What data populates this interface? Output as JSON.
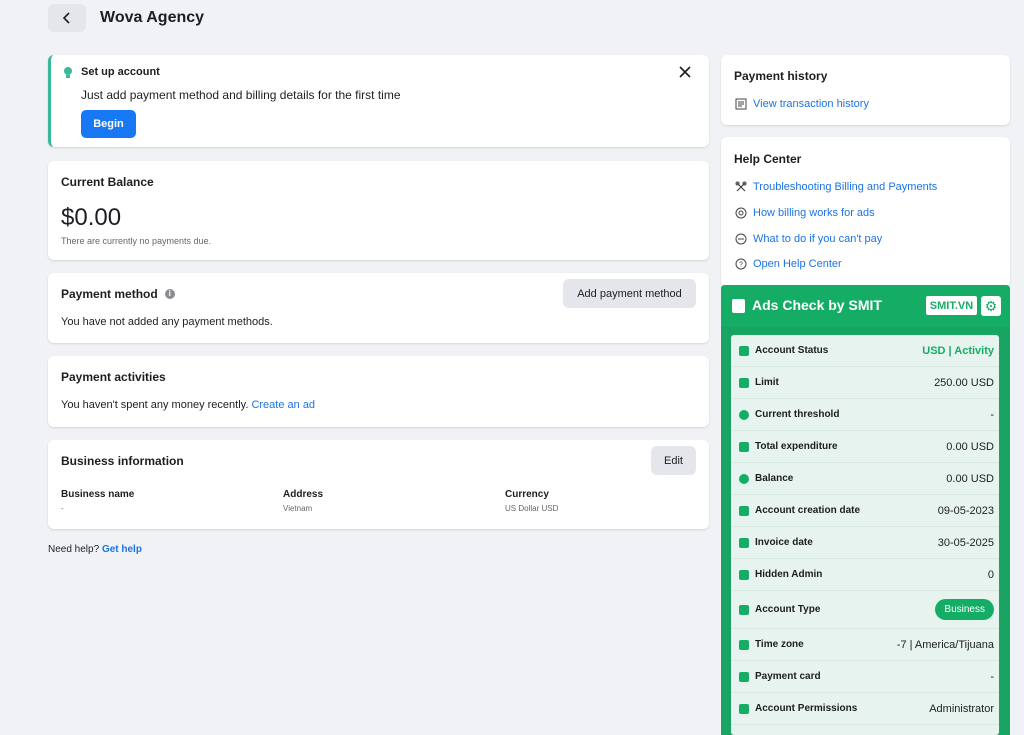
{
  "header": {
    "title": "Wova Agency"
  },
  "setup": {
    "title": "Set up account",
    "description": "Just add payment method and billing details for the first time",
    "begin_label": "Begin"
  },
  "balance": {
    "title": "Current Balance",
    "amount": "$0.00",
    "note": "There are currently no payments due."
  },
  "payment_method": {
    "title": "Payment method",
    "description": "You have not added any payment methods.",
    "add_label": "Add payment method"
  },
  "payment_activities": {
    "title": "Payment activities",
    "description": "You haven't spent any money recently.",
    "link": "Create an ad"
  },
  "business": {
    "title": "Business information",
    "edit_label": "Edit",
    "columns": [
      {
        "label": "Business name",
        "value": "-"
      },
      {
        "label": "Address",
        "value": "Vietnam"
      },
      {
        "label": "Currency",
        "value": "US Dollar USD"
      }
    ]
  },
  "help_footer": {
    "text": "Need help?",
    "link": "Get help"
  },
  "payment_history": {
    "title": "Payment history",
    "link": "View transaction history"
  },
  "help_center": {
    "title": "Help Center",
    "links": [
      "Troubleshooting Billing and Payments",
      "How billing works for ads",
      "What to do if you can't pay",
      "Open Help Center"
    ]
  },
  "smit": {
    "title": "Ads Check by SMIT",
    "badge": "SMIT.VN",
    "accent_color": "#15ad66",
    "rows": [
      {
        "label": "Account Status",
        "value": "USD | Activity"
      },
      {
        "label": "Limit",
        "value": "250.00 USD"
      },
      {
        "label": "Current threshold",
        "value": "-"
      },
      {
        "label": "Total expenditure",
        "value": "0.00 USD"
      },
      {
        "label": "Balance",
        "value": "0.00 USD"
      },
      {
        "label": "Account creation date",
        "value": "09-05-2023"
      },
      {
        "label": "Invoice date",
        "value": "30-05-2025"
      },
      {
        "label": "Hidden Admin",
        "value": "0"
      },
      {
        "label": "Account Type",
        "value": "Business"
      },
      {
        "label": "Time zone",
        "value": "-7 | America/Tijuana"
      },
      {
        "label": "Payment card",
        "value": "-"
      },
      {
        "label": "Account Permissions",
        "value": "Administrator"
      }
    ]
  }
}
